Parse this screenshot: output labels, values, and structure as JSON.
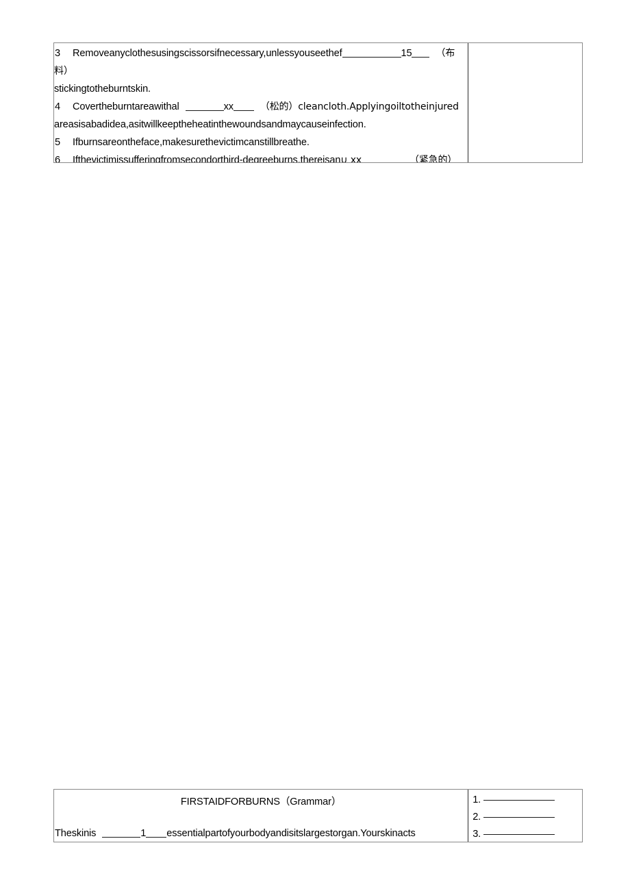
{
  "document": {
    "page_background": "#ffffff",
    "table_border_color": "#8a8a8a",
    "text_color": "#000000"
  },
  "top_table": {
    "name": "first-aid-steps-table",
    "right_cell_content": "",
    "lines": [
      {
        "number": "3",
        "segments": [
          {
            "type": "text",
            "value": "Removeanyclothesusingscissorsifnecessary,unlessyouseethef"
          },
          {
            "type": "blank",
            "width": "long"
          },
          {
            "type": "text",
            "value": "15"
          },
          {
            "type": "blank",
            "width": "short"
          },
          {
            "type": "text",
            "value": "（布"
          }
        ]
      },
      {
        "number": "",
        "segments": [
          {
            "type": "text",
            "value": "料）"
          }
        ]
      },
      {
        "number": "",
        "segments": [
          {
            "type": "text",
            "value": "stickingtotheburntskin."
          }
        ]
      },
      {
        "number": "4",
        "segments": [
          {
            "type": "text",
            "value": "Covertheburntareawithal"
          },
          {
            "type": "blank",
            "width": "mid"
          },
          {
            "type": "text",
            "value": "xx"
          },
          {
            "type": "blank",
            "width": "sm"
          },
          {
            "type": "text",
            "value": "（松的）cleancloth.Applyingoiltotheinjured"
          }
        ]
      },
      {
        "number": "",
        "segments": [
          {
            "type": "text",
            "value": "areasisabadidea,asitwillkeeptheheatinthewoundsandmaycauseinfection."
          }
        ]
      },
      {
        "number": "5",
        "segments": [
          {
            "type": "text",
            "value": "Ifburnsareontheface,makesurethevictimcanstillbreathe."
          }
        ]
      },
      {
        "number": "6",
        "segments": [
          {
            "type": "text",
            "value": "Ifthevictimissufferingfromsecondorthird-degreeburns,thereisan"
          },
          {
            "type": "text",
            "value": "∪ xx"
          },
          {
            "type": "gap"
          },
          {
            "type": "text",
            "value": "（紧急的）"
          }
        ]
      }
    ],
    "line_3_text": "Removeanyclothesusingscissorsifnecessary,unlessyouseethef",
    "line_3_number_value": "15",
    "line_3_tail": "（布",
    "line_3b": "料）",
    "line_3c": "stickingtotheburntskin.",
    "line_4_head": "Covertheburntareawithal",
    "line_4_mid": "xx",
    "line_4_tail": "（松的）cleancloth.Applyingoiltotheinjured",
    "line_4b": "areasisabadidea,asitwillkeeptheheatinthewoundsandmaycauseinfection.",
    "line_5": "Ifburnsareontheface,makesurethevictimcanstillbreathe.",
    "line_6_head": "Ifthevictimissufferingfromsecondorthird-degreeburns,thereisan",
    "line_6_symbol": "∪ xx",
    "line_6_tail": "（紧急的）",
    "numbers": {
      "n3": "3",
      "n4": "4",
      "n5": "5",
      "n6": "6"
    }
  },
  "bottom_table": {
    "name": "grammar-exercise-table",
    "title": "FIRSTAIDFORBURNS（Grammar）",
    "body_head": "Theskinis",
    "body_number": "1",
    "body_tail": "essentialpartofyourbodyandisitslargestorgan.Yourskinacts",
    "answers": [
      {
        "label": "1."
      },
      {
        "label": "2."
      },
      {
        "label": "3."
      }
    ],
    "answer_1_label": "1.",
    "answer_2_label": "2.",
    "answer_3_label": "3."
  }
}
